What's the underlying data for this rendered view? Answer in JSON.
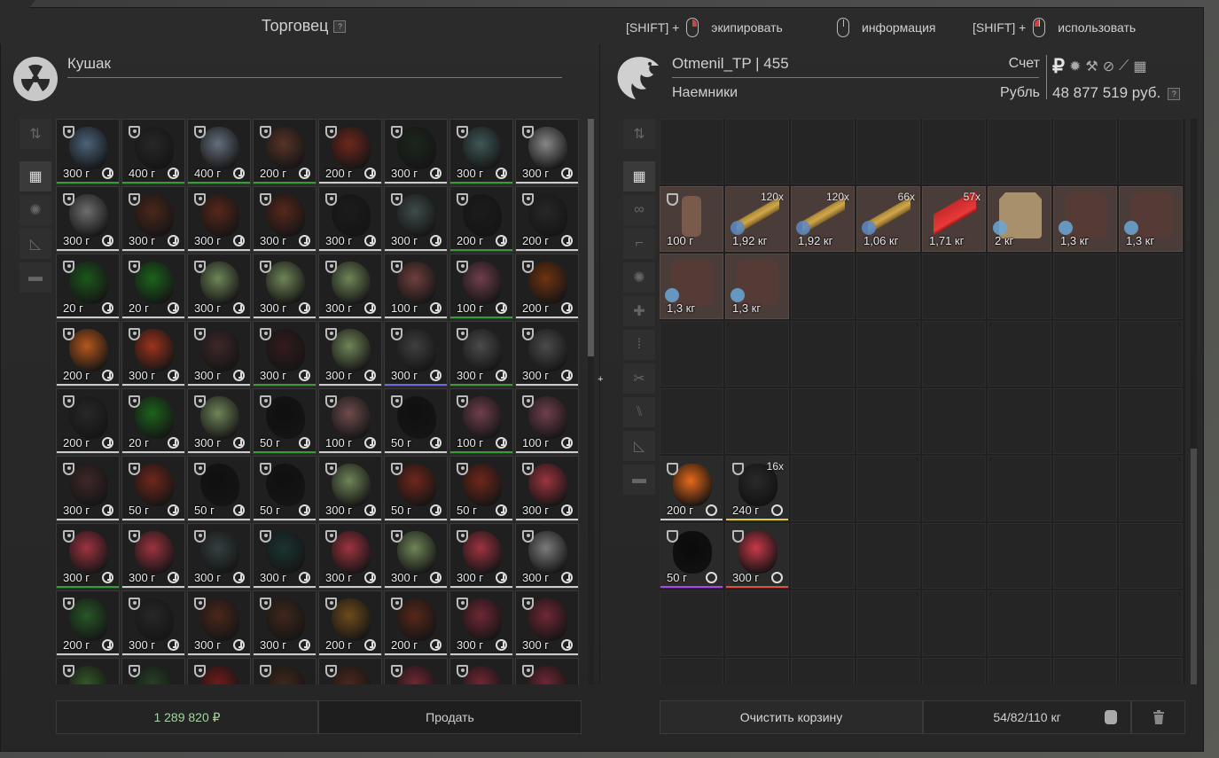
{
  "top": {
    "trader_title": "Торговец",
    "help": "?",
    "hint_equip_prefix": "[SHIFT] +",
    "hint_equip": "экипировать",
    "hint_info": "информация",
    "hint_use_prefix": "[SHIFT] +",
    "hint_use": "использовать"
  },
  "left": {
    "name": "Кушак",
    "total": "1 289 820 ₽",
    "sell_label": "Продать",
    "items": [
      {
        "w": "300 г",
        "c": "#5a7a9a",
        "b": "#3a9a3a"
      },
      {
        "w": "400 г",
        "c": "#2a2a2a",
        "b": "#3a9a3a"
      },
      {
        "w": "400 г",
        "c": "#7a8a9a",
        "b": "#3a9a3a"
      },
      {
        "w": "200 г",
        "c": "#6a3a2a",
        "b": "#3a9a3a"
      },
      {
        "w": "200 г",
        "c": "#8a2a1a",
        "b": "#ccc"
      },
      {
        "w": "300 г",
        "c": "#1a2a1a",
        "b": "#ccc"
      },
      {
        "w": "300 г",
        "c": "#4a6a6a",
        "b": "#3a9a3a"
      },
      {
        "w": "300 г",
        "c": "#aaaaaa",
        "b": "#ccc"
      },
      {
        "w": "300 г",
        "c": "#888888",
        "b": "#ccc"
      },
      {
        "w": "300 г",
        "c": "#5a2a1a",
        "b": "#ccc"
      },
      {
        "w": "300 г",
        "c": "#6a2a1a",
        "b": "#ccc"
      },
      {
        "w": "300 г",
        "c": "#6a2a1a",
        "b": "#ccc"
      },
      {
        "w": "300 г",
        "c": "#1a1a1a",
        "b": "#ccc"
      },
      {
        "w": "300 г",
        "c": "#4a5a5a",
        "b": "#ccc"
      },
      {
        "w": "200 г",
        "c": "#1a1a1a",
        "b": "#3a9a3a"
      },
      {
        "w": "200 г",
        "c": "#2a2a2a",
        "b": "#ccc"
      },
      {
        "w": "20 г",
        "c": "#1a6a1a",
        "b": "#ccc"
      },
      {
        "w": "20 г",
        "c": "#1a7a1a",
        "b": "#ccc"
      },
      {
        "w": "300 г",
        "c": "#8aa86a",
        "b": "#ccc"
      },
      {
        "w": "300 г",
        "c": "#8aa86a",
        "b": "#ccc"
      },
      {
        "w": "300 г",
        "c": "#8aa86a",
        "b": "#ccc"
      },
      {
        "w": "100 г",
        "c": "#8a4a4a",
        "b": "#ccc"
      },
      {
        "w": "100 г",
        "c": "#8a4a5a",
        "b": "#3a9a3a"
      },
      {
        "w": "200 г",
        "c": "#8a3a0a",
        "b": "#ccc"
      },
      {
        "w": "200 г",
        "c": "#e86a1a",
        "b": "#ccc"
      },
      {
        "w": "300 г",
        "c": "#c83a1a",
        "b": "#ccc"
      },
      {
        "w": "300 г",
        "c": "#4a2a2a",
        "b": "#ccc"
      },
      {
        "w": "300 г",
        "c": "#3a1a1a",
        "b": "#3a9a3a"
      },
      {
        "w": "300 г",
        "c": "#8aa86a",
        "b": "#ccc"
      },
      {
        "w": "300 г",
        "c": "#4a4a4a",
        "b": "#6a6ae8"
      },
      {
        "w": "300 г",
        "c": "#5a5a5a",
        "b": "#3a9a3a"
      },
      {
        "w": "300 г",
        "c": "#5a5a5a",
        "b": "#ccc"
      },
      {
        "w": "200 г",
        "c": "#2a2a2a",
        "b": "#ccc"
      },
      {
        "w": "20 г",
        "c": "#1a7a1a",
        "b": "#ccc"
      },
      {
        "w": "300 г",
        "c": "#8aa86a",
        "b": "#ccc"
      },
      {
        "w": "50 г",
        "c": "#0a0a0a",
        "b": "#3a9a3a"
      },
      {
        "w": "100 г",
        "c": "#8a5a5a",
        "b": "#ccc"
      },
      {
        "w": "50 г",
        "c": "#0a0a0a",
        "b": "#ccc"
      },
      {
        "w": "100 г",
        "c": "#8a4a5a",
        "b": "#3a9a3a"
      },
      {
        "w": "100 г",
        "c": "#8a4a5a",
        "b": "#ccc"
      },
      {
        "w": "300 г",
        "c": "#4a2a2a",
        "b": "#ccc"
      },
      {
        "w": "50 г",
        "c": "#8a2a1a",
        "b": "#ccc"
      },
      {
        "w": "50 г",
        "c": "#0a0a0a",
        "b": "#ccc"
      },
      {
        "w": "50 г",
        "c": "#0a0a0a",
        "b": "#ccc"
      },
      {
        "w": "300 г",
        "c": "#8aa86a",
        "b": "#ccc"
      },
      {
        "w": "50 г",
        "c": "#8a2a1a",
        "b": "#ccc"
      },
      {
        "w": "50 г",
        "c": "#8a2a1a",
        "b": "#ccc"
      },
      {
        "w": "300 г",
        "c": "#c83a4a",
        "b": "#ccc"
      },
      {
        "w": "300 г",
        "c": "#c83a4a",
        "b": "#3a9a3a"
      },
      {
        "w": "300 г",
        "c": "#c83a4a",
        "b": "#ccc"
      },
      {
        "w": "300 г",
        "c": "#3a4a4a",
        "b": "#ccc"
      },
      {
        "w": "300 г",
        "c": "#1a3a3a",
        "b": "#ccc"
      },
      {
        "w": "300 г",
        "c": "#c83a4a",
        "b": "#ccc"
      },
      {
        "w": "300 г",
        "c": "#8aa86a",
        "b": "#ccc"
      },
      {
        "w": "300 г",
        "c": "#c83a4a",
        "b": "#ccc"
      },
      {
        "w": "300 г",
        "c": "#9a9a9a",
        "b": "#ccc"
      },
      {
        "w": "200 г",
        "c": "#2a6a2a",
        "b": "#ccc"
      },
      {
        "w": "300 г",
        "c": "#2a2a2a",
        "b": "#ccc"
      },
      {
        "w": "300 г",
        "c": "#5a2a1a",
        "b": "#ccc"
      },
      {
        "w": "300 г",
        "c": "#4a2a1a",
        "b": "#ccc"
      },
      {
        "w": "200 г",
        "c": "#8a5a1a",
        "b": "#ccc"
      },
      {
        "w": "200 г",
        "c": "#6a2a1a",
        "b": "#ccc"
      },
      {
        "w": "300 г",
        "c": "#8a2a3a",
        "b": "#ccc"
      },
      {
        "w": "300 г",
        "c": "#8a2a3a",
        "b": "#ccc"
      },
      {
        "w": "",
        "c": "#3a6a2a",
        "b": "#ccc"
      },
      {
        "w": "",
        "c": "#2a4a2a",
        "b": "#ccc"
      },
      {
        "w": "",
        "c": "#8a1a1a",
        "b": "#ccc"
      },
      {
        "w": "",
        "c": "#4a2a1a",
        "b": "#ccc"
      },
      {
        "w": "",
        "c": "#5a2a1a",
        "b": "#ccc"
      },
      {
        "w": "",
        "c": "#8a2a3a",
        "b": "#ccc"
      },
      {
        "w": "",
        "c": "#8a2a3a",
        "b": "#ccc"
      },
      {
        "w": "",
        "c": "#8a2a3a",
        "b": "#ccc"
      }
    ]
  },
  "right": {
    "player_name": "Otmenil_TP | 455",
    "faction": "Наемники",
    "account_label": "Счет",
    "currency_label": "Рубль",
    "currency_symbol": "₽",
    "balance": "48 877 519 руб.",
    "clear_label": "Очистить корзину",
    "weight_info": "54/82/110 кг",
    "items": [
      {
        "w": "100 г",
        "n": "",
        "t": "bottle",
        "shield": true
      },
      {
        "w": "1,92 кг",
        "n": "120x",
        "t": "ammo"
      },
      {
        "w": "1,92 кг",
        "n": "120x",
        "t": "ammo"
      },
      {
        "w": "1,06 кг",
        "n": "66x",
        "t": "ammo"
      },
      {
        "w": "1,71 кг",
        "n": "57x",
        "t": "shell"
      },
      {
        "w": "2 кг",
        "n": "",
        "t": "plate"
      },
      {
        "w": "1,3 кг",
        "n": "",
        "t": "armor"
      },
      {
        "w": "1,3 кг",
        "n": "",
        "t": "armor"
      },
      {
        "w": "1,3 кг",
        "n": "",
        "t": "armor"
      },
      {
        "w": "1,3 кг",
        "n": "",
        "t": "armor"
      }
    ],
    "artifacts": [
      {
        "w": "200 г",
        "n": "",
        "c": "#e86a1a",
        "b": "#ccc"
      },
      {
        "w": "240 г",
        "n": "16x",
        "c": "#2a2a2a",
        "b": "#e8c83a"
      },
      {
        "w": "50 г",
        "n": "",
        "c": "#0a0a0a",
        "b": "#a84ae8"
      },
      {
        "w": "300 г",
        "n": "",
        "c": "#c83a4a",
        "b": "#e84a4a"
      }
    ]
  }
}
